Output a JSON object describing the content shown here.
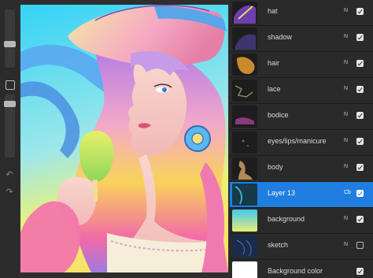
{
  "layers": [
    {
      "name": "hat",
      "blend": "N",
      "visible": true,
      "thumb_color": "#6d3fb0"
    },
    {
      "name": "shadow",
      "blend": "N",
      "visible": true,
      "thumb_color": "#3d3470"
    },
    {
      "name": "hair",
      "blend": "N",
      "visible": true,
      "thumb_color": "#c98a2e"
    },
    {
      "name": "lace",
      "blend": "N",
      "visible": true,
      "thumb_color": "#4a4a2a"
    },
    {
      "name": "bodice",
      "blend": "N",
      "visible": true,
      "thumb_color": "#5a2a55"
    },
    {
      "name": "eyes/lips/manicure",
      "blend": "N",
      "visible": true,
      "thumb_color": "#2c2c2c"
    },
    {
      "name": "body",
      "blend": "N",
      "visible": true,
      "thumb_color": "#b08a55"
    },
    {
      "name": "Layer 13",
      "blend": "Cb",
      "visible": true,
      "active": true,
      "thumb_color": "#1b4a5a"
    },
    {
      "name": "background",
      "blend": "N",
      "visible": true,
      "thumb_color": "#6fc0e0"
    },
    {
      "name": "sketch",
      "blend": "N",
      "visible": false,
      "thumb_color": "#243a66"
    },
    {
      "name": "Background color",
      "blend": "",
      "visible": true,
      "thumb_color": "#ffffff"
    }
  ],
  "colors": {
    "accent": "#1f7ee0",
    "panel": "#2a2a2a"
  },
  "toolbar": {
    "brush_size_icon": "slider-handle",
    "opacity_icon": "slider-handle",
    "modify_icon": "square-outline-icon",
    "undo_icon": "undo-arrow-icon",
    "redo_icon": "redo-arrow-icon"
  }
}
